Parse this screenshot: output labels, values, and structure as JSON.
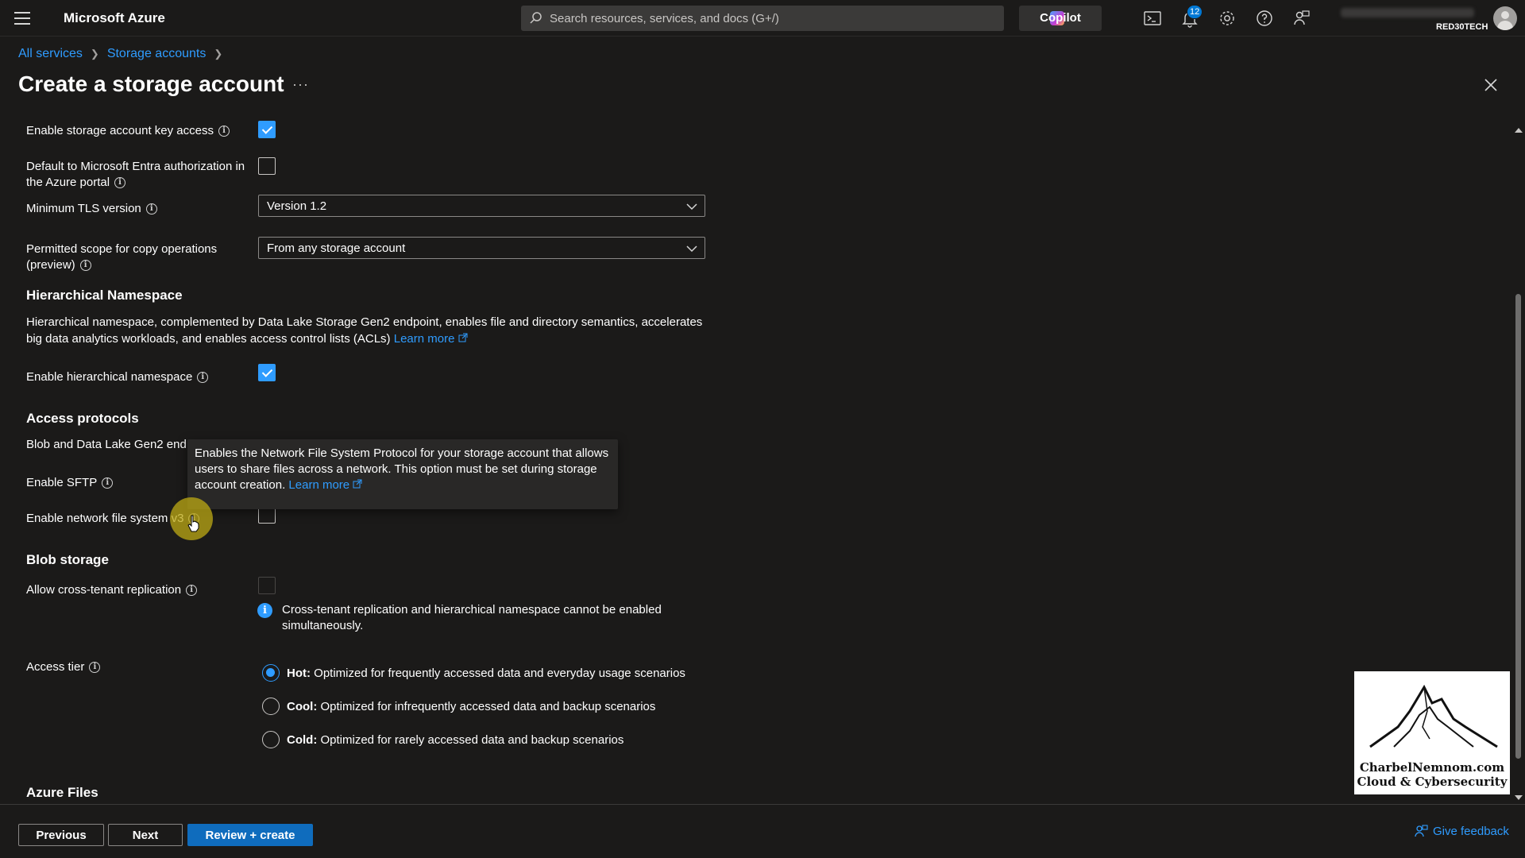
{
  "topbar": {
    "brand": "Microsoft Azure",
    "search_placeholder": "Search resources, services, and docs (G+/)",
    "copilot_label": "Copilot",
    "notification_count": "12",
    "tenant": "RED30TECH",
    "icons": [
      "menu-icon",
      "search-icon",
      "cloud-shell-icon",
      "bell-icon",
      "gear-icon",
      "help-icon",
      "feedback-icon",
      "avatar"
    ]
  },
  "breadcrumb": [
    "All services",
    "Storage accounts"
  ],
  "page_title": "Create a storage account",
  "more_label": "···",
  "form": {
    "key_access_label": "Enable storage account key access",
    "key_access_checked": true,
    "entra_label_1": "Default to Microsoft Entra authorization in",
    "entra_label_2": "the Azure portal",
    "entra_checked": false,
    "tls_label": "Minimum TLS version",
    "tls_value": "Version 1.2",
    "copy_scope_label_1": "Permitted scope for copy operations",
    "copy_scope_label_2": "(preview)",
    "copy_scope_value": "From any storage account",
    "hns_heading": "Hierarchical Namespace",
    "hns_desc_1": "Hierarchical namespace, complemented by Data Lake Storage Gen2 endpoint, enables file and directory semantics, accelerates",
    "hns_desc_2": "big data analytics workloads, and enables access control lists (ACLs)",
    "learn_more": "Learn more",
    "hns_label": "Enable hierarchical namespace",
    "hns_checked": true,
    "access_heading": "Access protocols",
    "blob_dl_label": "Blob and Data Lake Gen2 end",
    "sftp_label": "Enable SFTP",
    "nfs_label": "Enable network file system v3",
    "nfs_checked": false,
    "tooltip_1": "Enables the Network File System Protocol for your storage account that allows",
    "tooltip_2": "users to share files across a network. This option must be set during storage",
    "tooltip_3": "account creation.",
    "tooltip_link": "Learn more",
    "blob_heading": "Blob storage",
    "cross_tenant_label": "Allow cross-tenant replication",
    "cross_tenant_checked": false,
    "cross_tenant_note_1": "Cross-tenant replication and hierarchical namespace cannot be enabled",
    "cross_tenant_note_2": "simultaneously.",
    "access_tier_label": "Access tier",
    "tiers": [
      {
        "name": "Hot:",
        "desc": "Optimized for frequently accessed data and everyday usage scenarios",
        "selected": true
      },
      {
        "name": "Cool:",
        "desc": "Optimized for infrequently accessed data and backup scenarios",
        "selected": false
      },
      {
        "name": "Cold:",
        "desc": "Optimized for rarely accessed data and backup scenarios",
        "selected": false
      }
    ],
    "azure_files_heading": "Azure Files"
  },
  "footer": {
    "previous": "Previous",
    "next": "Next",
    "review": "Review + create",
    "feedback": "Give feedback"
  },
  "watermark": {
    "line1": "CharbelNemnom.com",
    "line2": "Cloud & Cybersecurity"
  },
  "colors": {
    "accent": "#2f9cff",
    "primary_button": "#0f6cbd",
    "background": "#1b1a19"
  }
}
